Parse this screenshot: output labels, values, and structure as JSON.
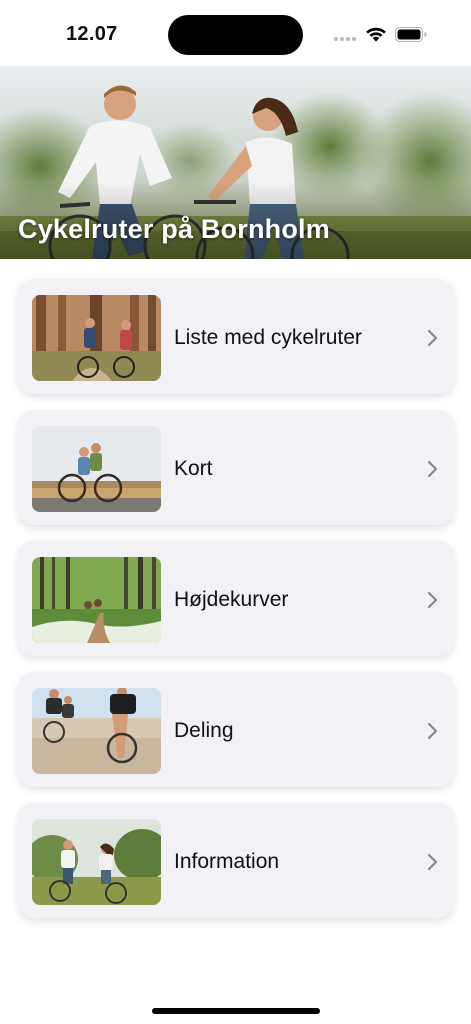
{
  "status_bar": {
    "time": "12.07"
  },
  "hero": {
    "title": "Cykelruter på Bornholm"
  },
  "menu": [
    {
      "label": "Liste med cykelruter",
      "icon": "chevron-right-icon"
    },
    {
      "label": "Kort",
      "icon": "chevron-right-icon"
    },
    {
      "label": "Højdekurver",
      "icon": "chevron-right-icon"
    },
    {
      "label": "Deling",
      "icon": "chevron-right-icon"
    },
    {
      "label": "Information",
      "icon": "chevron-right-icon"
    }
  ],
  "colors": {
    "card_background": "#f2f1f6",
    "chevron": "#8a8a8e",
    "text": "#111111"
  }
}
